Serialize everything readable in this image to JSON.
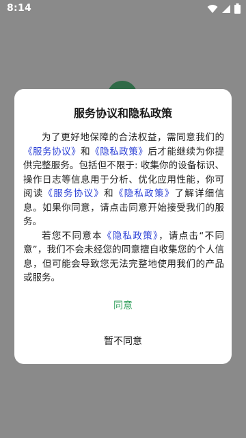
{
  "status_bar": {
    "time": "8:14",
    "icons": [
      "wifi-icon",
      "cellular-signal-icon",
      "battery-icon"
    ]
  },
  "dialog": {
    "title": "服务协议和隐私政策",
    "p1": {
      "t1": "为了更好地保障的合法权益，需同意我们的",
      "link1": "《服务协议》",
      "t2": "和",
      "link2": "《隐私政策》",
      "t3": "后才能继续为你提供完整服务。包括但不限于: 收集你的设备标识、操作日志等信息用于分析、优化应用性能，你可阅读",
      "link3": "《服务协议》",
      "t4": "和",
      "link4": "《隐私政策》",
      "t5": "了解详细信息。如果你同意，请点击同意开始接受我们的服务。"
    },
    "p2": {
      "t1": "若您不同意本",
      "link1": "《隐私政策》",
      "t2": "，请点击“不同意”，我们不会未经您的同意擅自收集您的个人信息，但可能会导致您无法完整地使用我们的产品或服务。"
    },
    "agree_label": "同意",
    "disagree_label": "暂不同意"
  },
  "colors": {
    "overlay": "#8a8a8a",
    "link": "#2a3fd6",
    "agree": "#2f9e5a",
    "logo": "#2f6a47"
  }
}
